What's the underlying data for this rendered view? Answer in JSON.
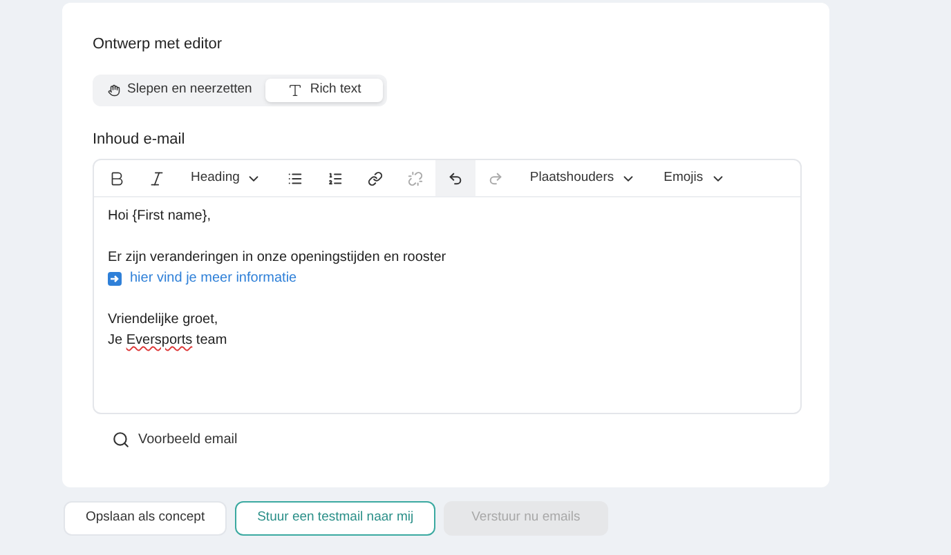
{
  "editor_mode": {
    "label": "Ontwerp met editor",
    "options": [
      {
        "label": "Slepen en neerzetten",
        "selected": false
      },
      {
        "label": "Rich text",
        "selected": true
      }
    ]
  },
  "content": {
    "label": "Inhoud e-mail",
    "toolbar": [
      {
        "kind": "button",
        "disabled": false,
        "highlighted": false
      },
      {
        "kind": "button",
        "disabled": false,
        "highlighted": false
      },
      {
        "kind": "dropdown",
        "label": "Heading",
        "disabled": false,
        "highlighted": false
      },
      {
        "kind": "button",
        "disabled": false,
        "highlighted": false
      },
      {
        "kind": "button",
        "disabled": false,
        "highlighted": false
      },
      {
        "kind": "button",
        "disabled": false,
        "highlighted": false
      },
      {
        "kind": "button",
        "disabled": true,
        "highlighted": false
      },
      {
        "kind": "button",
        "disabled": false,
        "highlighted": true
      },
      {
        "kind": "button",
        "disabled": true,
        "highlighted": false
      },
      {
        "kind": "dropdown",
        "label": "Plaatshouders",
        "disabled": false,
        "highlighted": false
      },
      {
        "kind": "dropdown",
        "label": "Emojis",
        "disabled": false,
        "highlighted": false
      }
    ],
    "lines": [
      {
        "kind": "text",
        "segments": [
          {
            "text": "Hoi {First name},",
            "misspelled": false
          }
        ]
      },
      {
        "kind": "blank"
      },
      {
        "kind": "text",
        "segments": [
          {
            "text": "Er zijn veranderingen in onze openingstijden en rooster",
            "misspelled": false
          }
        ]
      },
      {
        "kind": "link",
        "text": "hier vind je meer informatie"
      },
      {
        "kind": "blank"
      },
      {
        "kind": "text",
        "segments": [
          {
            "text": "Vriendelijke groet,",
            "misspelled": false
          }
        ]
      },
      {
        "kind": "text",
        "segments": [
          {
            "text": "Je ",
            "misspelled": false
          },
          {
            "text": "Eversports",
            "misspelled": true
          },
          {
            "text": " team",
            "misspelled": false
          }
        ]
      }
    ]
  },
  "preview": {
    "label": "Voorbeeld email"
  },
  "actions": [
    {
      "kind": "secondary",
      "label": "Opslaan als concept",
      "disabled": false
    },
    {
      "kind": "outline",
      "label": "Stuur een testmail naar mij",
      "disabled": false
    },
    {
      "kind": "primary",
      "label": "Verstuur nu emails",
      "disabled": true
    }
  ]
}
